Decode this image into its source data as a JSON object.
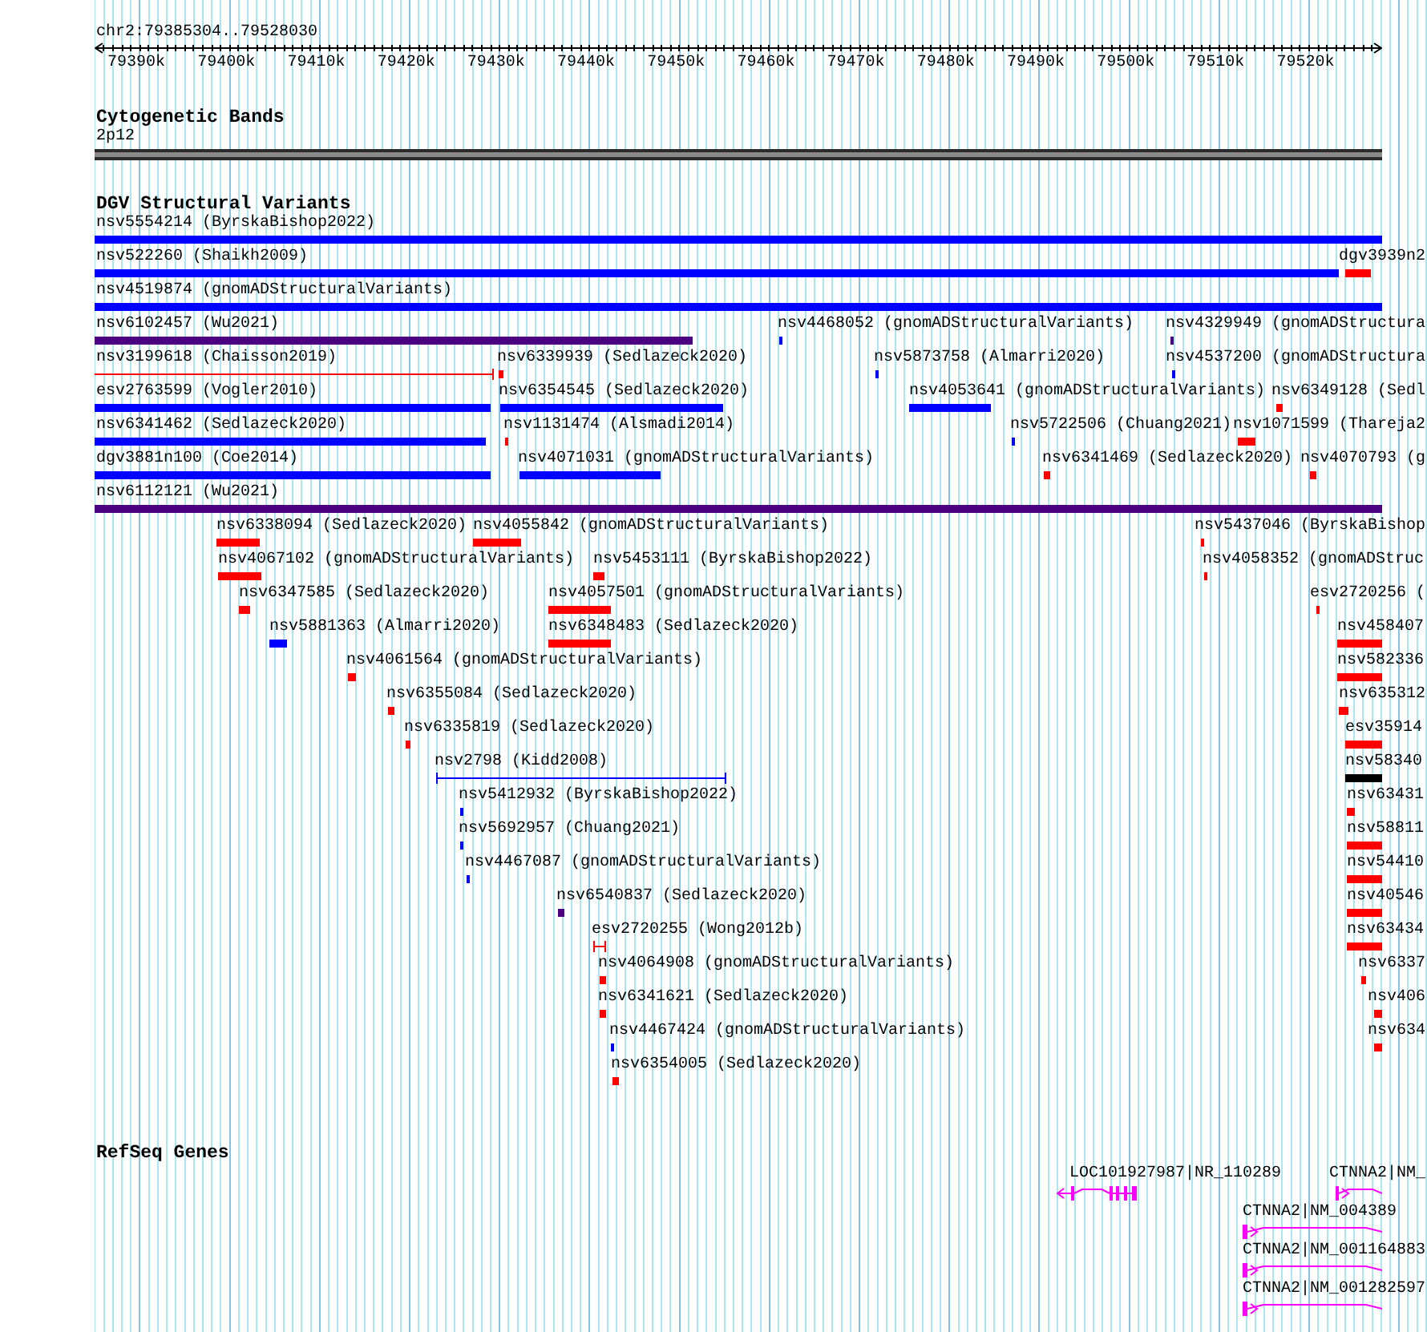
{
  "ruler": {
    "location": "chr2:79385304..79528030",
    "ticks": [
      "79390k",
      "79400k",
      "79410k",
      "79420k",
      "79430k",
      "79440k",
      "79450k",
      "79460k",
      "79470k",
      "79480k",
      "79490k",
      "79500k",
      "79510k",
      "79520k"
    ]
  },
  "tracks": [
    {
      "title": "Cytogenetic Bands",
      "kind": "bands",
      "features": [
        {
          "label": "2p12"
        }
      ]
    },
    {
      "title": "DGV Structural Variants",
      "kind": "variants",
      "features": [
        {
          "label": "nsv5554214 (ByrskaBishop2022)",
          "kind": "bar",
          "color": "#0000ff"
        },
        {
          "label": "nsv522260 (Shaikh2009)",
          "kind": "bar",
          "color": "#0000ff"
        },
        {
          "label": "dgv3939n2",
          "kind": "bar",
          "color": "#ff0000"
        },
        {
          "label": "nsv4519874 (gnomADStructuralVariants)",
          "kind": "bar",
          "color": "#0000ff"
        },
        {
          "label": "nsv6102457 (Wu2021)",
          "kind": "bar",
          "color": "#4b0082"
        },
        {
          "label": "nsv4468052 (gnomADStructuralVariants)",
          "kind": "bar",
          "color": "#0000ff"
        },
        {
          "label": "nsv4329949 (gnomADStructura",
          "kind": "bar",
          "color": "#4b0082"
        },
        {
          "label": "nsv3199618 (Chaisson2019)",
          "kind": "span",
          "color": "#ff0000"
        },
        {
          "label": "nsv6339939 (Sedlazeck2020)",
          "kind": "bar",
          "color": "#ff0000"
        },
        {
          "label": "nsv5873758 (Almarri2020)",
          "kind": "bar",
          "color": "#0000ff"
        },
        {
          "label": "nsv4537200 (gnomADStructura",
          "kind": "bar",
          "color": "#0000ff"
        },
        {
          "label": "esv2763599 (Vogler2010)",
          "kind": "bar",
          "color": "#0000ff"
        },
        {
          "label": "nsv6354545 (Sedlazeck2020)",
          "kind": "bar",
          "color": "#0000ff"
        },
        {
          "label": "nsv4053641 (gnomADStructuralVariants)",
          "kind": "bar",
          "color": "#0000ff"
        },
        {
          "label": "nsv6349128 (Sedl",
          "kind": "bar",
          "color": "#ff0000"
        },
        {
          "label": "nsv6341462 (Sedlazeck2020)",
          "kind": "bar",
          "color": "#0000ff"
        },
        {
          "label": "nsv1131474 (Alsmadi2014)",
          "kind": "bar",
          "color": "#ff0000"
        },
        {
          "label": "nsv5722506 (Chuang2021)",
          "kind": "bar",
          "color": "#0000ff"
        },
        {
          "label": "nsv1071599 (Thareja2",
          "kind": "bar",
          "color": "#ff0000"
        },
        {
          "label": "dgv3881n100 (Coe2014)",
          "kind": "bar",
          "color": "#0000ff"
        },
        {
          "label": "nsv4071031 (gnomADStructuralVariants)",
          "kind": "bar",
          "color": "#0000ff"
        },
        {
          "label": "nsv6341469 (Sedlazeck2020)",
          "kind": "bar",
          "color": "#ff0000"
        },
        {
          "label": "nsv4070793 (g",
          "kind": "bar",
          "color": "#ff0000"
        },
        {
          "label": "nsv6112121 (Wu2021)",
          "kind": "bar",
          "color": "#4b0082"
        },
        {
          "label": "nsv6338094 (Sedlazeck2020)",
          "kind": "bar",
          "color": "#ff0000"
        },
        {
          "label": "nsv4055842 (gnomADStructuralVariants)",
          "kind": "bar",
          "color": "#ff0000"
        },
        {
          "label": "nsv5437046 (ByrskaBishop",
          "kind": "bar",
          "color": "#ff0000"
        },
        {
          "label": "nsv4067102 (gnomADStructuralVariants)",
          "kind": "bar",
          "color": "#ff0000"
        },
        {
          "label": "nsv5453111 (ByrskaBishop2022)",
          "kind": "bar",
          "color": "#ff0000"
        },
        {
          "label": "nsv4058352 (gnomADStruc",
          "kind": "bar",
          "color": "#ff0000"
        },
        {
          "label": "nsv6347585 (Sedlazeck2020)",
          "kind": "bar",
          "color": "#ff0000"
        },
        {
          "label": "nsv4057501 (gnomADStructuralVariants)",
          "kind": "bar",
          "color": "#ff0000"
        },
        {
          "label": "esv2720256 (",
          "kind": "bar",
          "color": "#ff0000"
        },
        {
          "label": "nsv5881363 (Almarri2020)",
          "kind": "bar",
          "color": "#0000ff"
        },
        {
          "label": "nsv6348483 (Sedlazeck2020)",
          "kind": "bar",
          "color": "#ff0000"
        },
        {
          "label": "nsv458407",
          "kind": "bar",
          "color": "#ff0000"
        },
        {
          "label": "nsv4061564 (gnomADStructuralVariants)",
          "kind": "bar",
          "color": "#ff0000"
        },
        {
          "label": "nsv582336",
          "kind": "bar",
          "color": "#ff0000"
        },
        {
          "label": "nsv6355084 (Sedlazeck2020)",
          "kind": "bar",
          "color": "#ff0000"
        },
        {
          "label": "nsv635312",
          "kind": "bar",
          "color": "#ff0000"
        },
        {
          "label": "nsv6335819 (Sedlazeck2020)",
          "kind": "bar",
          "color": "#ff0000"
        },
        {
          "label": "esv35914",
          "kind": "bar",
          "color": "#ff0000"
        },
        {
          "label": "nsv2798 (Kidd2008)",
          "kind": "span",
          "color": "#0000ff"
        },
        {
          "label": "nsv58340",
          "kind": "bar",
          "color": "#000000"
        },
        {
          "label": "nsv5412932 (ByrskaBishop2022)",
          "kind": "bar",
          "color": "#0000ff"
        },
        {
          "label": "nsv63431",
          "kind": "bar",
          "color": "#ff0000"
        },
        {
          "label": "nsv5692957 (Chuang2021)",
          "kind": "bar",
          "color": "#0000ff"
        },
        {
          "label": "nsv58811",
          "kind": "bar",
          "color": "#ff0000"
        },
        {
          "label": "nsv4467087 (gnomADStructuralVariants)",
          "kind": "bar",
          "color": "#0000ff"
        },
        {
          "label": "nsv54410",
          "kind": "bar",
          "color": "#ff0000"
        },
        {
          "label": "nsv6540837 (Sedlazeck2020)",
          "kind": "bar",
          "color": "#4b0082"
        },
        {
          "label": "nsv40546",
          "kind": "bar",
          "color": "#ff0000"
        },
        {
          "label": "esv2720255 (Wong2012b)",
          "kind": "span",
          "color": "#ff0000"
        },
        {
          "label": "nsv63434",
          "kind": "bar",
          "color": "#ff0000"
        },
        {
          "label": "nsv4064908 (gnomADStructuralVariants)",
          "kind": "bar",
          "color": "#ff0000"
        },
        {
          "label": "nsv6337",
          "kind": "bar",
          "color": "#ff0000"
        },
        {
          "label": "nsv6341621 (Sedlazeck2020)",
          "kind": "bar",
          "color": "#ff0000"
        },
        {
          "label": "nsv406",
          "kind": "bar",
          "color": "#ff0000"
        },
        {
          "label": "nsv4467424 (gnomADStructuralVariants)",
          "kind": "bar",
          "color": "#0000ff"
        },
        {
          "label": "nsv634",
          "kind": "bar",
          "color": "#ff0000"
        },
        {
          "label": "nsv6354005 (Sedlazeck2020)",
          "kind": "bar",
          "color": "#ff0000"
        }
      ]
    },
    {
      "title": "RefSeq Genes",
      "kind": "genes",
      "features": [
        {
          "label": "LOC101927987|NR_110289",
          "reverse": true
        },
        {
          "label": "CTNNA2|NM_",
          "reverse": false
        },
        {
          "label": "CTNNA2|NM_004389",
          "reverse": false
        },
        {
          "label": "CTNNA2|NM_001164883",
          "reverse": false
        },
        {
          "label": "CTNNA2|NM_001282597",
          "reverse": false
        }
      ]
    }
  ]
}
